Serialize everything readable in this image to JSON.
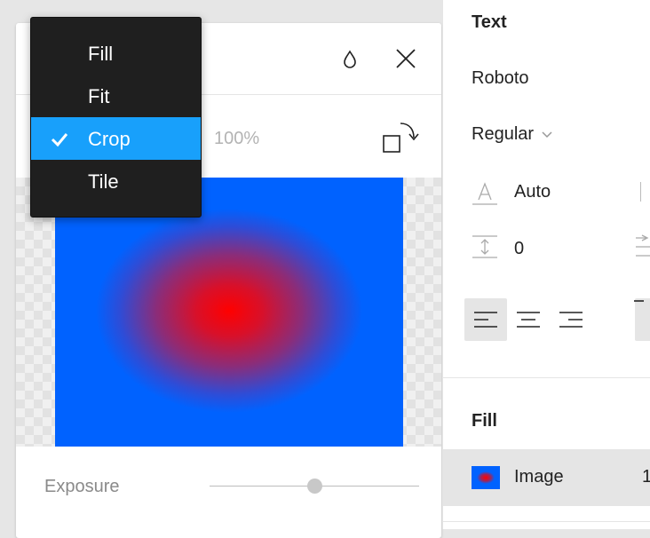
{
  "image_panel": {
    "zoom": "100%",
    "icons": {
      "drop": "drop-icon",
      "close": "close-icon",
      "rotate": "rotate-icon"
    },
    "exposure": {
      "label": "Exposure",
      "value": 0.5
    }
  },
  "scale_menu": {
    "items": [
      {
        "label": "Fill",
        "selected": false
      },
      {
        "label": "Fit",
        "selected": false
      },
      {
        "label": "Crop",
        "selected": true
      },
      {
        "label": "Tile",
        "selected": false
      }
    ]
  },
  "text_section": {
    "title": "Text",
    "font_family": "Roboto",
    "font_weight": "Regular",
    "line_height": "Auto",
    "paragraph_spacing": "0",
    "alignment": [
      "align-left",
      "align-center",
      "align-right"
    ],
    "active_alignment": "align-left"
  },
  "fill_section": {
    "title": "Fill",
    "layer": {
      "label": "Image",
      "opacity": "1"
    }
  },
  "colors": {
    "menu_bg": "#1f1f1f",
    "selected": "#18a0fb",
    "image_outer": "#0062ff",
    "image_center": "#ff0000"
  }
}
